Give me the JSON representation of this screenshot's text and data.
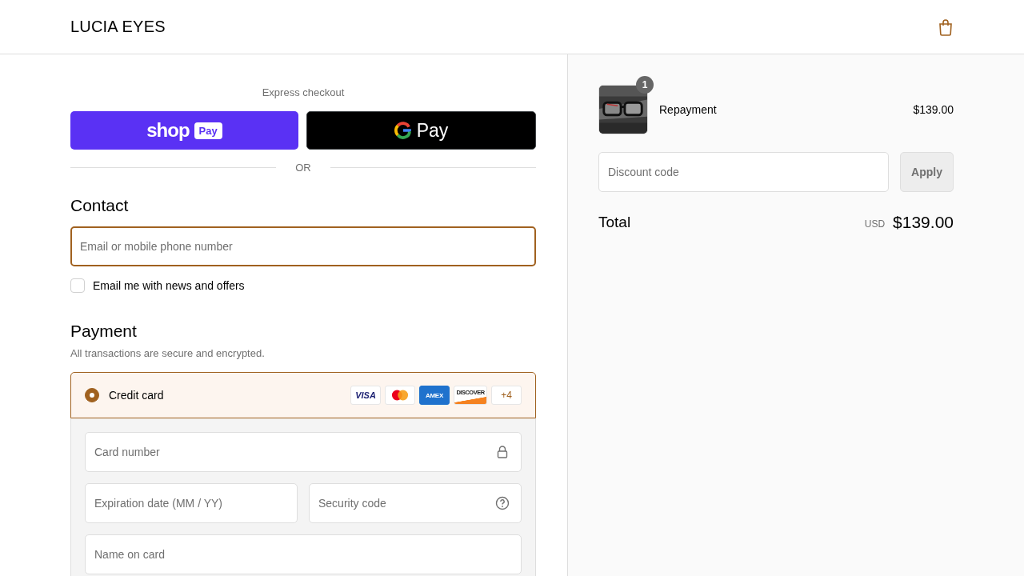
{
  "header": {
    "brand": "LUCIA EYES"
  },
  "express_checkout": {
    "title": "Express checkout",
    "buttons": [
      {
        "kind": "shop_pay",
        "label": "shop",
        "badge": "Pay"
      },
      {
        "kind": "google_pay",
        "label": "Pay"
      }
    ],
    "divider": "OR"
  },
  "contact": {
    "title": "Contact",
    "email_field": {
      "placeholder": "Email or mobile phone number",
      "focused": true
    },
    "newsletter": {
      "label": "Email me with news and offers",
      "checked": false
    }
  },
  "payment": {
    "title": "Payment",
    "subtitle": "All transactions are secure and encrypted.",
    "methods": [
      {
        "label": "Credit card",
        "selected": true,
        "brands": [
          {
            "kind": "visa",
            "label": "VISA"
          },
          {
            "kind": "mastercard"
          },
          {
            "kind": "amex",
            "label": "AMEX"
          },
          {
            "kind": "discover",
            "label": "DISCOVER"
          },
          {
            "kind": "more",
            "label": "+4"
          }
        ]
      }
    ],
    "card_fields": [
      [
        {
          "placeholder": "Card number",
          "kind": "secure"
        }
      ],
      [
        {
          "placeholder": "Expiration date (MM / YY)",
          "kind": "plain"
        },
        {
          "placeholder": "Security code",
          "kind": "help"
        }
      ],
      [
        {
          "placeholder": "Name on card",
          "kind": "plain"
        }
      ]
    ]
  },
  "order_summary": {
    "items": [
      {
        "name": "Repayment",
        "price": "$139.00",
        "quantity": "1",
        "kind": "picture"
      }
    ],
    "discount": {
      "placeholder": "Discount code",
      "button": "Apply",
      "disabled": true
    },
    "total": {
      "label": "Total",
      "currency": "USD",
      "amount": "$139.00"
    }
  }
}
